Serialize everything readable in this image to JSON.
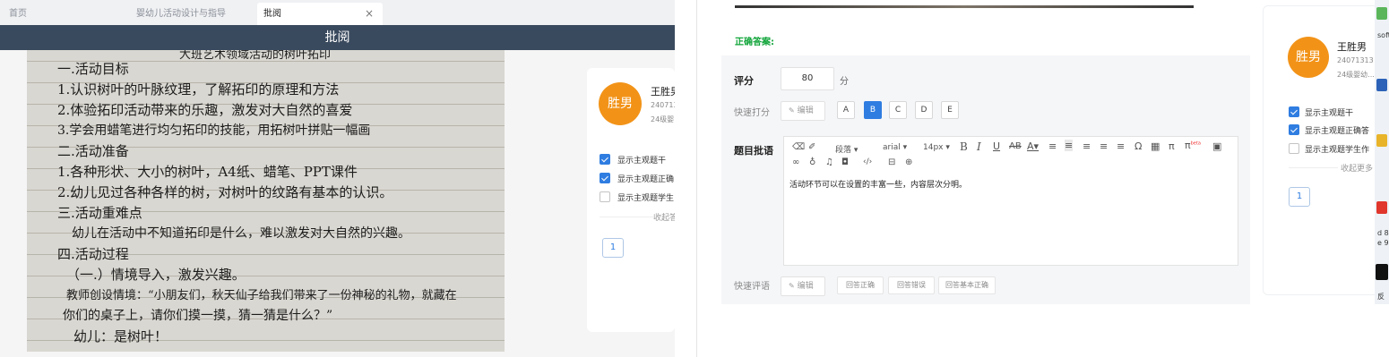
{
  "tabs": [
    {
      "label": "首页"
    },
    {
      "label": "婴幼儿活动设计与指导"
    },
    {
      "label": "批阅",
      "close": "×"
    }
  ],
  "title": "批阅",
  "handwriting": [
    "大班艺术领域活动的树叶拓印",
    "一.活动目标",
    "1.认识树叶的叶脉纹理，了解拓印的原理和方法",
    "2.体验拓印活动带来的乐趣，激发对大自然的喜爱",
    "3.学会用蜡笔进行均匀拓印的技能，用拓树叶拼贴一幅画",
    "二.活动准备",
    "1.各种形状、大小的树叶，A4纸、蜡笔、PPT课件",
    "2.幼儿见过各种各样的树，对树叶的纹路有基本的认识。",
    "三.活动重难点",
    "幼儿在活动中不知道拓印是什么，难以激发对大自然的兴趣。",
    "四.活动过程",
    "（一.）情境导入，激发兴趣。",
    "教师创设情境：“小朋友们，秋天仙子给我们带来了一份神秘的礼物，就藏在",
    "你们的桌子上，请你们摸一摸，猜一猜是什么？”",
    "幼儿：是树叶！"
  ],
  "student": {
    "avatar": "胜男",
    "name": "王胜男",
    "id_left": "240713",
    "id_right": "24071313",
    "class_left": "24级婴",
    "class_right": "24级婴幼..."
  },
  "options_left": [
    {
      "label": "显示主观题干",
      "checked": true
    },
    {
      "label": "显示主观题正确",
      "checked": true
    },
    {
      "label": "显示主观题学生",
      "checked": false
    }
  ],
  "options_right": [
    {
      "label": "显示主观题干",
      "checked": true
    },
    {
      "label": "显示主观题正确答",
      "checked": true
    },
    {
      "label": "显示主观题学生作",
      "checked": false
    }
  ],
  "collapse_left": "收起答",
  "collapse_right": "收起更多",
  "page": "1",
  "correct_answer_label": "正确答案:",
  "score": {
    "label": "评分",
    "value": "80",
    "unit": "分"
  },
  "quick_score": {
    "label": "快速打分",
    "edit": "编辑",
    "grades": [
      "A",
      "B",
      "C",
      "D",
      "E"
    ],
    "selected": "B"
  },
  "review": {
    "label": "题目批语",
    "para": "段落",
    "font": "arial",
    "size": "14px",
    "content": "活动环节可以在设置的丰富一些，内容层次分明。"
  },
  "quick_comment": {
    "label": "快速评语",
    "edit": "编辑",
    "buttons": [
      "回答正确",
      "回答错误",
      "回答基本正确"
    ]
  },
  "desktop": {
    "text1": "soft",
    "text2": "d 8",
    "text3": "e 9",
    "text4": "反"
  },
  "colors": {
    "accent": "#2f7de1",
    "avatar": "#f29318",
    "header": "#3a4a5e",
    "green": "#11a53a"
  }
}
